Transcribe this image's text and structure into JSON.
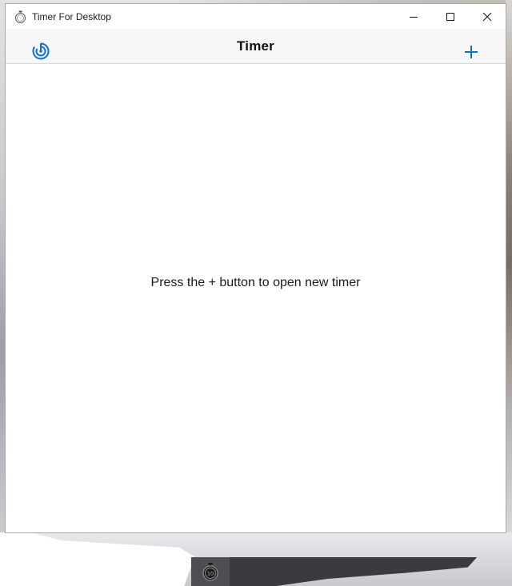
{
  "window": {
    "title": "Timer For Desktop",
    "controls": {
      "minimize_icon": "minimize-icon",
      "maximize_icon": "maximize-icon",
      "close_icon": "close-icon"
    }
  },
  "header": {
    "title": "Timer",
    "left_icon": "timer-dial-icon",
    "right_icon": "plus-icon"
  },
  "main": {
    "empty_message": "Press the + button to open new timer"
  },
  "taskbar": {
    "app_icon": "stopwatch-icon",
    "app_icon_label": "10"
  },
  "colors": {
    "accent": "#0a6fd6",
    "header_bg": "#f7f7f7",
    "window_bg": "#ffffff",
    "taskbar_bg": "#3b3b3f"
  }
}
